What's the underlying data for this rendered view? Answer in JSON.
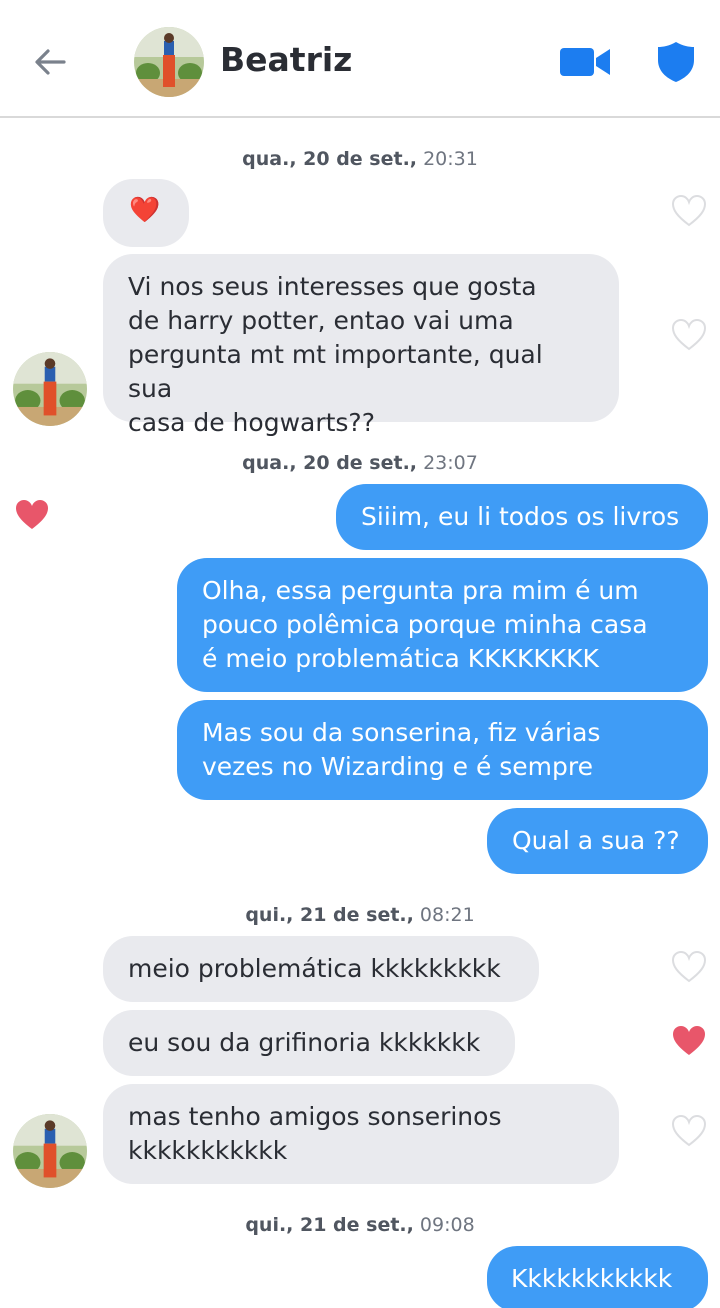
{
  "header": {
    "name": "Beatriz",
    "colors": {
      "accent": "#1c7df0",
      "back": "#7a818c"
    }
  },
  "messages": {
    "ts1": {
      "day": "qua., 20 de set.,",
      "time": "20:31"
    },
    "in1": "❤️",
    "in2": "Vi nos seus interesses que gosta\nde harry potter, entao vai uma\npergunta mt mt importante, qual sua\ncasa de hogwarts??",
    "ts2": {
      "day": "qua., 20 de set.,",
      "time": "23:07"
    },
    "out1": "Siiim, eu li todos os livros",
    "out2": "Olha, essa pergunta pra mim é um\npouco polêmica porque minha casa\né meio problemática KKKKKKKK",
    "out3": "Mas sou da sonserina, fiz várias\nvezes no Wizarding e é sempre",
    "out4": "Qual a sua ??",
    "ts3": {
      "day": "qui., 21 de set.,",
      "time": "08:21"
    },
    "in3": "meio problemática kkkkkkkkk",
    "in4": "eu sou da grifinoria kkkkkkk",
    "in5": "mas tenho amigos sonserinos\nkkkkkkkkkkk",
    "ts4": {
      "day": "qui., 21 de set.,",
      "time": "09:08"
    },
    "out5": "Kkkkkkkkkkk"
  },
  "colors": {
    "incoming_bubble": "#e9eaee",
    "outgoing_bubble": "#3f9cf6",
    "like_filled": "#e8566a",
    "like_empty": "#dcdde0"
  }
}
